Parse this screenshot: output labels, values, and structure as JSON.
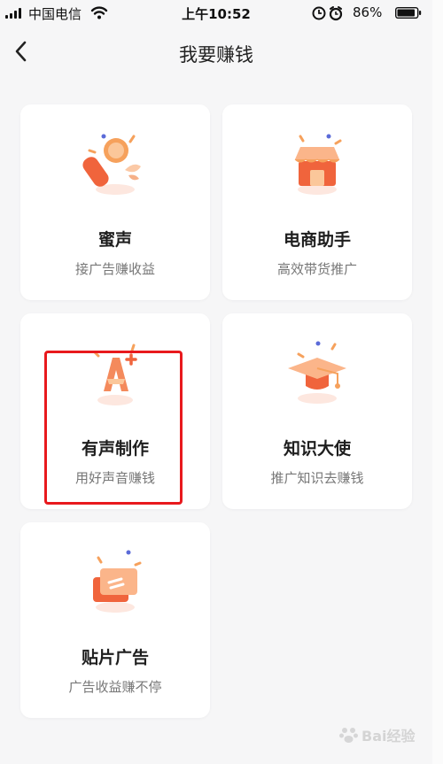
{
  "status_bar": {
    "carrier": "中国电信",
    "time": "上午10:52",
    "battery": "86%"
  },
  "nav": {
    "title": "我要赚钱"
  },
  "cards": [
    {
      "title": "蜜声",
      "subtitle": "接广告赚收益",
      "icon": "microphone-icon"
    },
    {
      "title": "电商助手",
      "subtitle": "高效带货推广",
      "icon": "shop-icon"
    },
    {
      "title": "有声制作",
      "subtitle": "用好声音赚钱",
      "icon": "letter-a-plus-icon"
    },
    {
      "title": "知识大使",
      "subtitle": "推广知识去赚钱",
      "icon": "graduation-cap-icon"
    },
    {
      "title": "贴片广告",
      "subtitle": "广告收益赚不停",
      "icon": "ad-card-icon"
    }
  ],
  "watermark": {
    "text": "Bai经验"
  },
  "colors": {
    "accent": "#f0643c",
    "highlight": "#e8191d"
  }
}
